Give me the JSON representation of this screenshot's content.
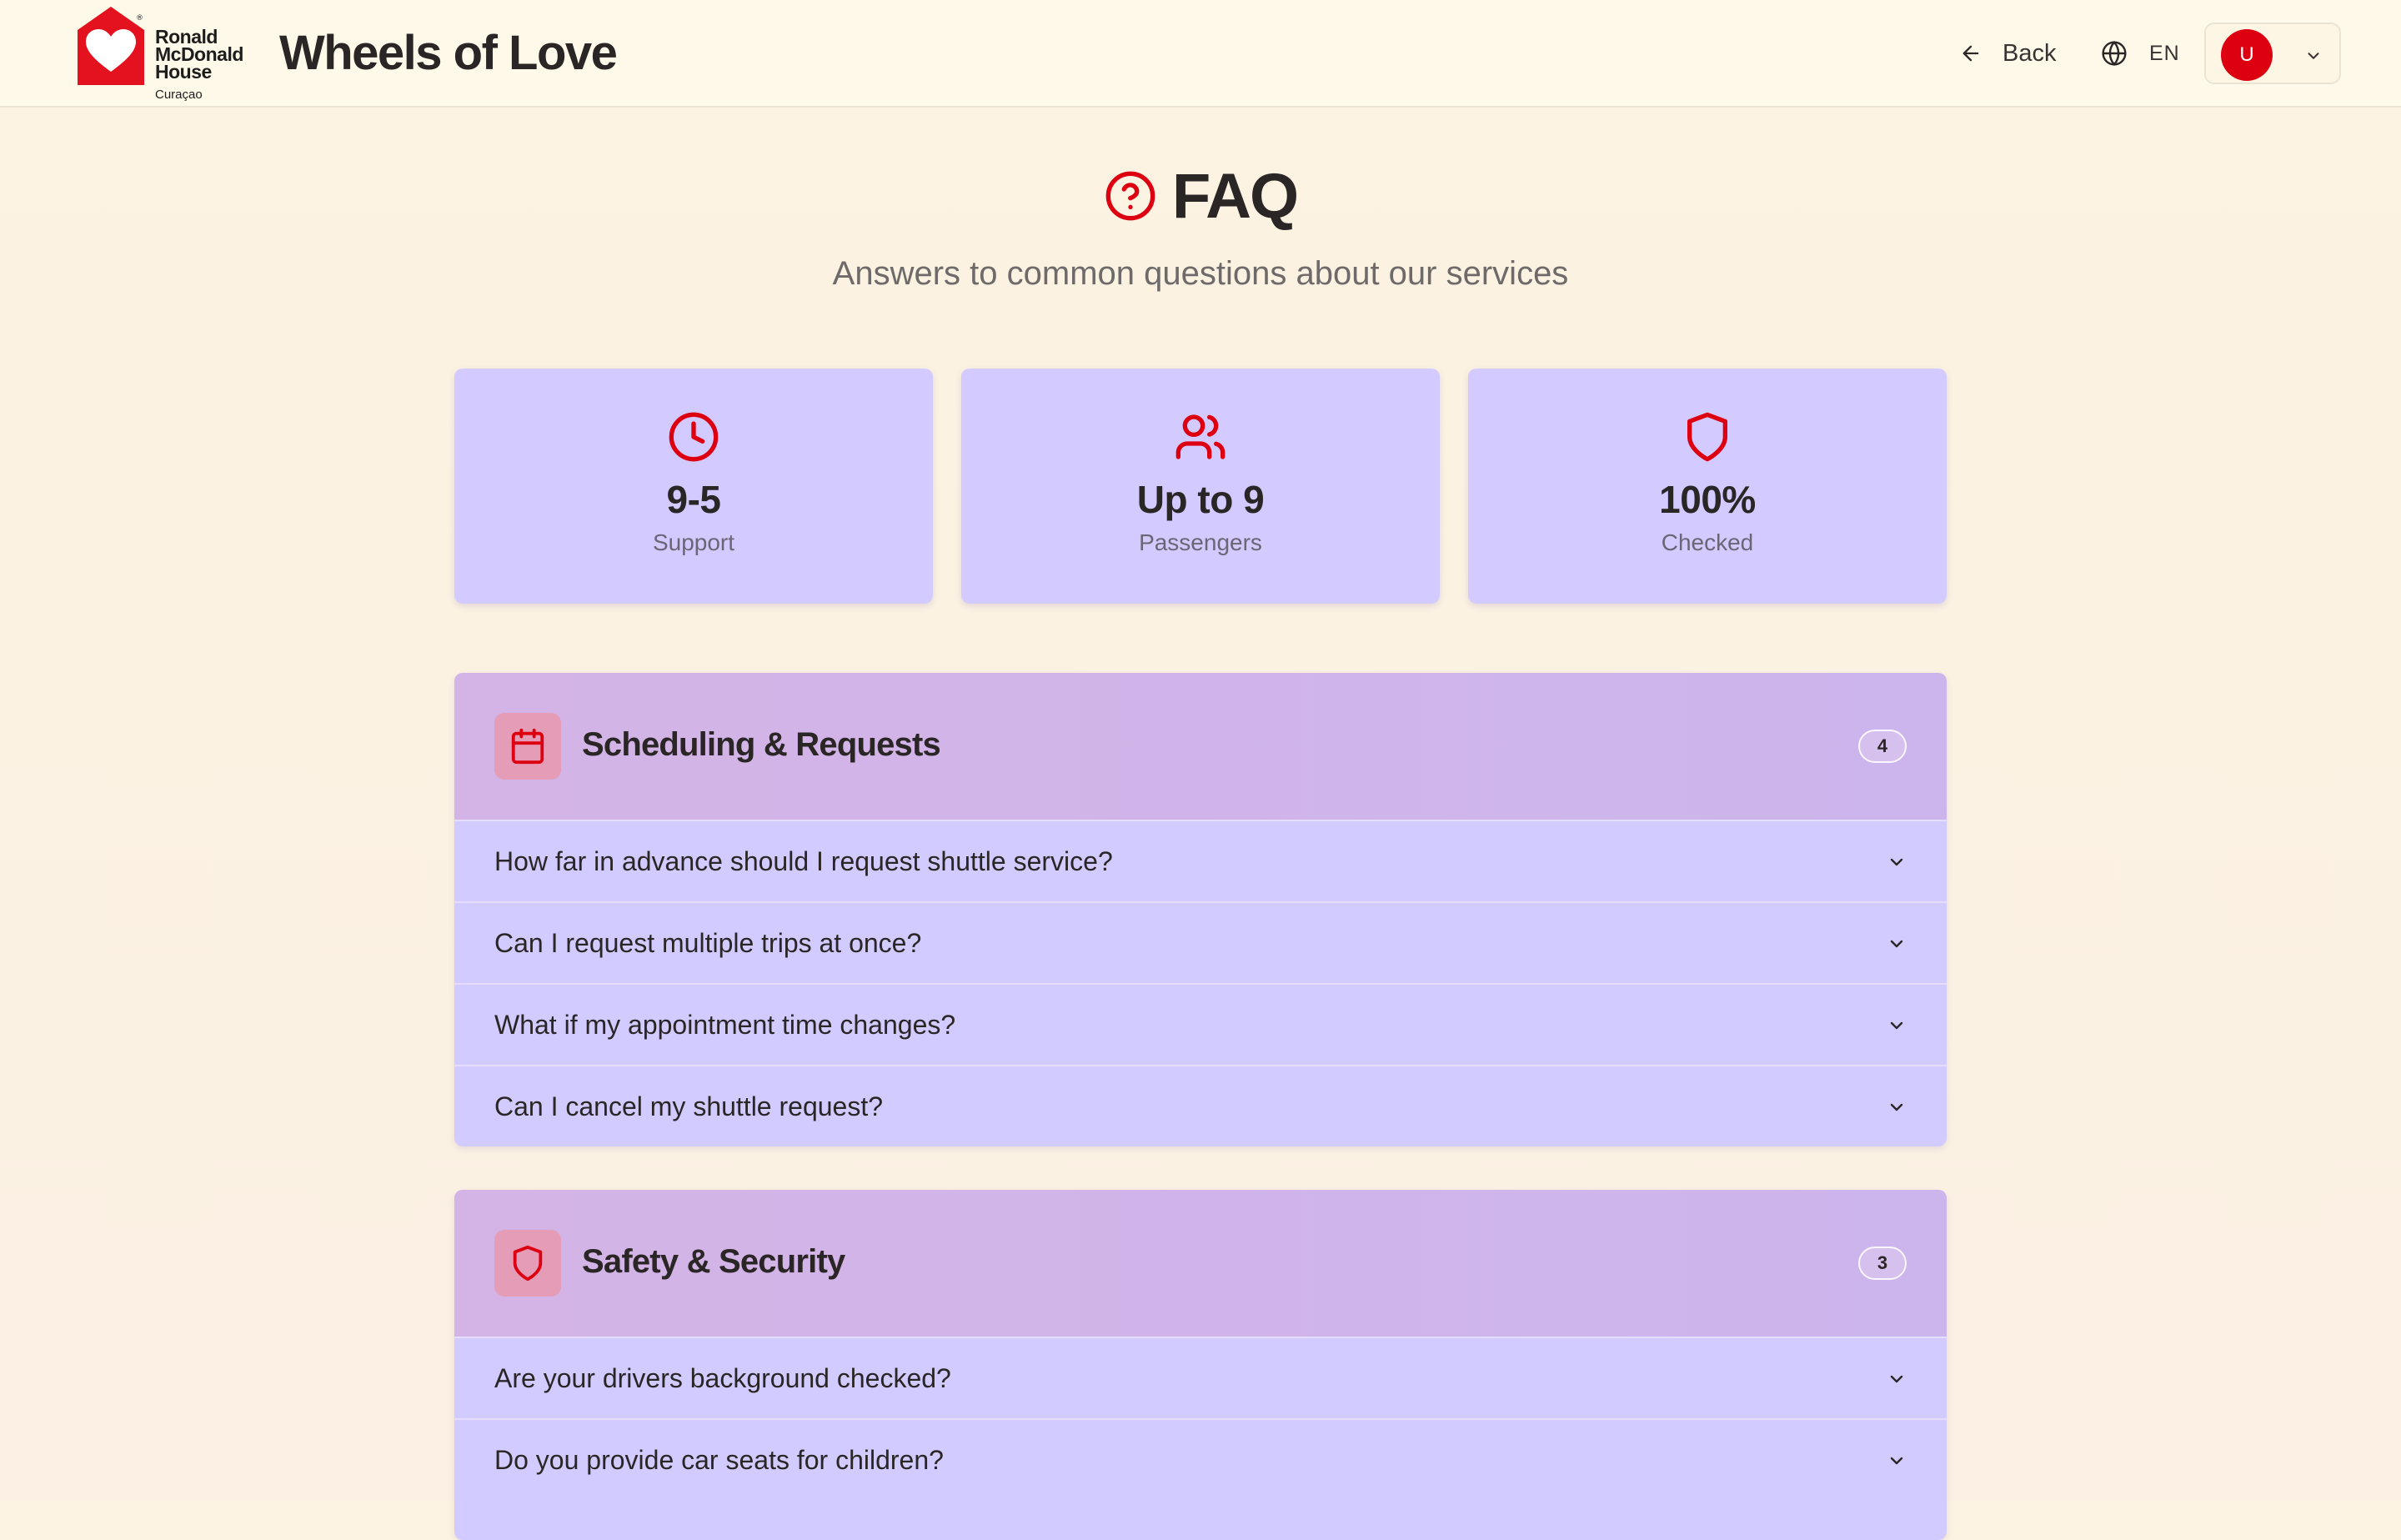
{
  "brand": {
    "logo_line1": "Ronald",
    "logo_line2": "McDonald",
    "logo_line3": "House",
    "logo_sub": "Curaçao",
    "app_title": "Wheels of Love"
  },
  "header": {
    "back_label": "Back",
    "language": "EN",
    "avatar_initial": "U"
  },
  "hero": {
    "title": "FAQ",
    "subtitle": "Answers to common questions about our services"
  },
  "stats": [
    {
      "value": "9-5",
      "label": "Support",
      "icon": "clock-icon"
    },
    {
      "value": "Up to 9",
      "label": "Passengers",
      "icon": "users-icon"
    },
    {
      "value": "100%",
      "label": "Checked",
      "icon": "shield-icon"
    }
  ],
  "sections": [
    {
      "title": "Scheduling & Requests",
      "count": "4",
      "icon": "calendar-icon",
      "questions": [
        "How far in advance should I request shuttle service?",
        "Can I request multiple trips at once?",
        "What if my appointment time changes?",
        "Can I cancel my shuttle request?"
      ]
    },
    {
      "title": "Safety & Security",
      "count": "3",
      "icon": "shield-icon",
      "questions": [
        "Are your drivers background checked?",
        "Do you provide car seats for children?"
      ]
    }
  ],
  "colors": {
    "brand_red": "#dd0011",
    "card_bg": "#d3cbff",
    "section_head": "#d4b4e6",
    "page_bg": "#fcf3e2"
  }
}
